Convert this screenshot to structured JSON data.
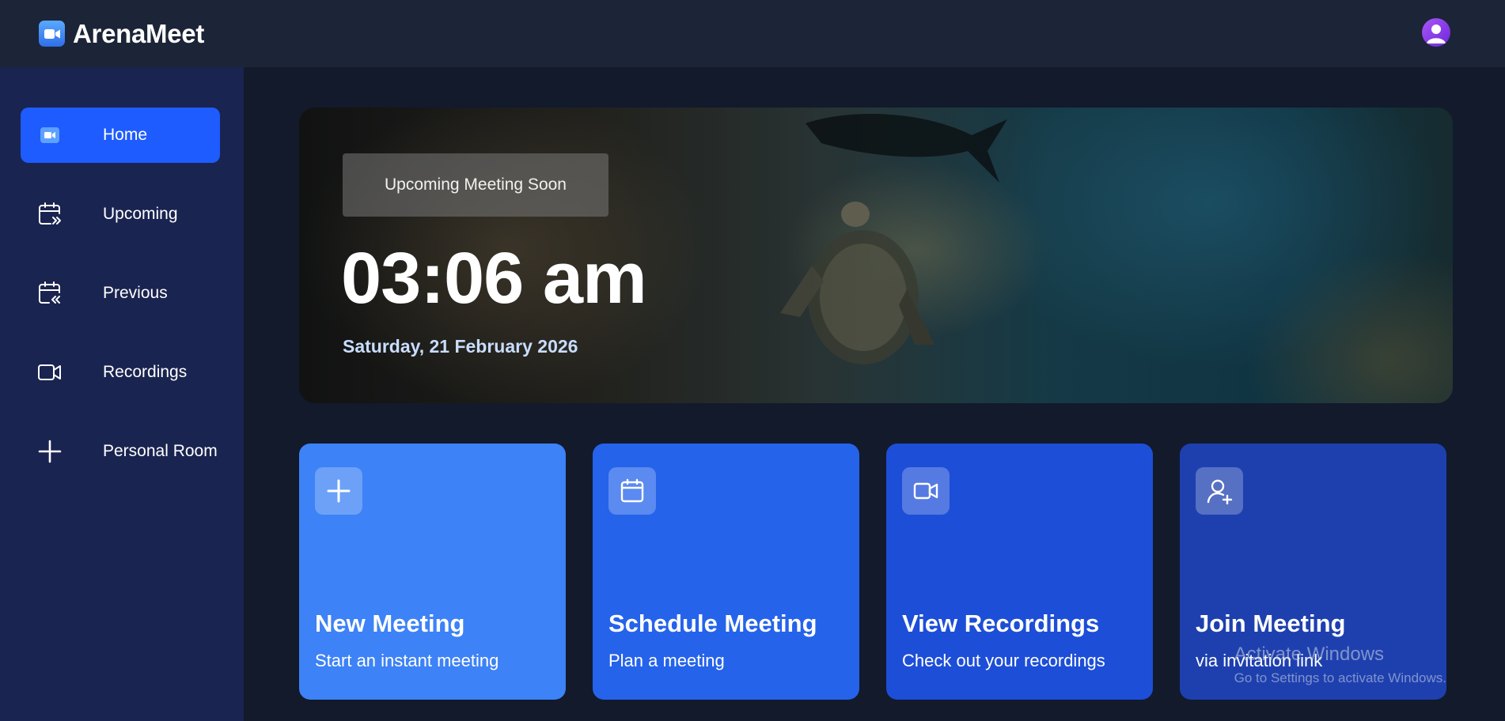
{
  "app": {
    "name": "ArenaMeet",
    "logo_icon": "video-camera-icon",
    "avatar_icon": "user-avatar-icon"
  },
  "sidebar": {
    "items": [
      {
        "label": "Home",
        "icon": "home-video-icon",
        "active": true
      },
      {
        "label": "Upcoming",
        "icon": "calendar-forward-icon",
        "active": false
      },
      {
        "label": "Previous",
        "icon": "calendar-back-icon",
        "active": false
      },
      {
        "label": "Recordings",
        "icon": "video-icon",
        "active": false
      },
      {
        "label": "Personal Room",
        "icon": "plus-icon",
        "active": false
      }
    ]
  },
  "hero": {
    "badge": "Upcoming Meeting Soon",
    "time": "03:06 am",
    "date": "Saturday, 21 February 2026"
  },
  "cards": [
    {
      "title": "New Meeting",
      "subtitle": "Start an instant meeting",
      "icon": "plus-icon",
      "color": "#3d82f6"
    },
    {
      "title": "Schedule Meeting",
      "subtitle": "Plan a meeting",
      "icon": "calendar-icon",
      "color": "#2563eb"
    },
    {
      "title": "View Recordings",
      "subtitle": "Check out your recordings",
      "icon": "video-icon",
      "color": "#1d4ed8"
    },
    {
      "title": "Join Meeting",
      "subtitle": "via invitation link",
      "icon": "user-plus-icon",
      "color": "#1e40af"
    }
  ],
  "watermark": {
    "title": "Activate Windows",
    "subtitle": "Go to Settings to activate Windows."
  },
  "colors": {
    "accent": "#1e5cff",
    "sidebar": "#1a2450",
    "topbar": "#1c2437",
    "main_bg": "#121a2c"
  }
}
